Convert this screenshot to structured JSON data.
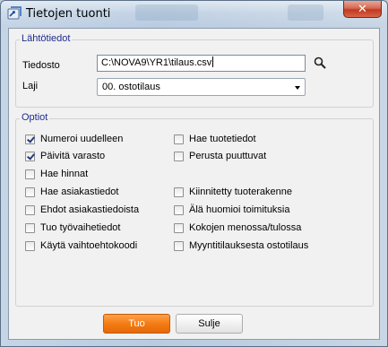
{
  "window": {
    "title": "Tietojen tuonti",
    "close_symbol": "✕",
    "icon": "app-icon"
  },
  "source_group": {
    "title": "Lähtötiedot",
    "file_label": "Tiedosto",
    "file_value": "C:\\NOVA9\\YR1\\tilaus.csv",
    "type_label": "Laji",
    "type_value": "00. ostotilaus",
    "search_icon": "search-icon",
    "dropdown_icon": "chevron-down-icon"
  },
  "options_group": {
    "title": "Optiot",
    "left": [
      {
        "label": "Numeroi uudelleen",
        "checked": true
      },
      {
        "label": "Päivitä varasto",
        "checked": true
      },
      {
        "label": "Hae hinnat",
        "checked": false
      },
      {
        "label": "Hae asiakastiedot",
        "checked": false
      },
      {
        "label": "Ehdot asiakastiedoista",
        "checked": false
      },
      {
        "label": "Tuo työvaihetiedot",
        "checked": false
      },
      {
        "label": "Käytä vaihtoehtokoodi",
        "checked": false
      }
    ],
    "right": [
      {
        "label": "Hae tuotetiedot",
        "checked": false
      },
      {
        "label": "Perusta puuttuvat",
        "checked": false
      },
      {
        "label": "Kiinnitetty tuoterakenne",
        "checked": false
      },
      {
        "label": "Älä huomioi toimituksia",
        "checked": false
      },
      {
        "label": "Kokojen menossa/tulossa",
        "checked": false
      },
      {
        "label": "Myyntitilauksesta ostotilaus",
        "checked": false
      }
    ]
  },
  "buttons": {
    "import_label": "Tuo",
    "close_label": "Sulje"
  },
  "colors": {
    "accent": "#f57c12",
    "group_title": "#1e2b8e",
    "close_button": "#c0391f"
  }
}
